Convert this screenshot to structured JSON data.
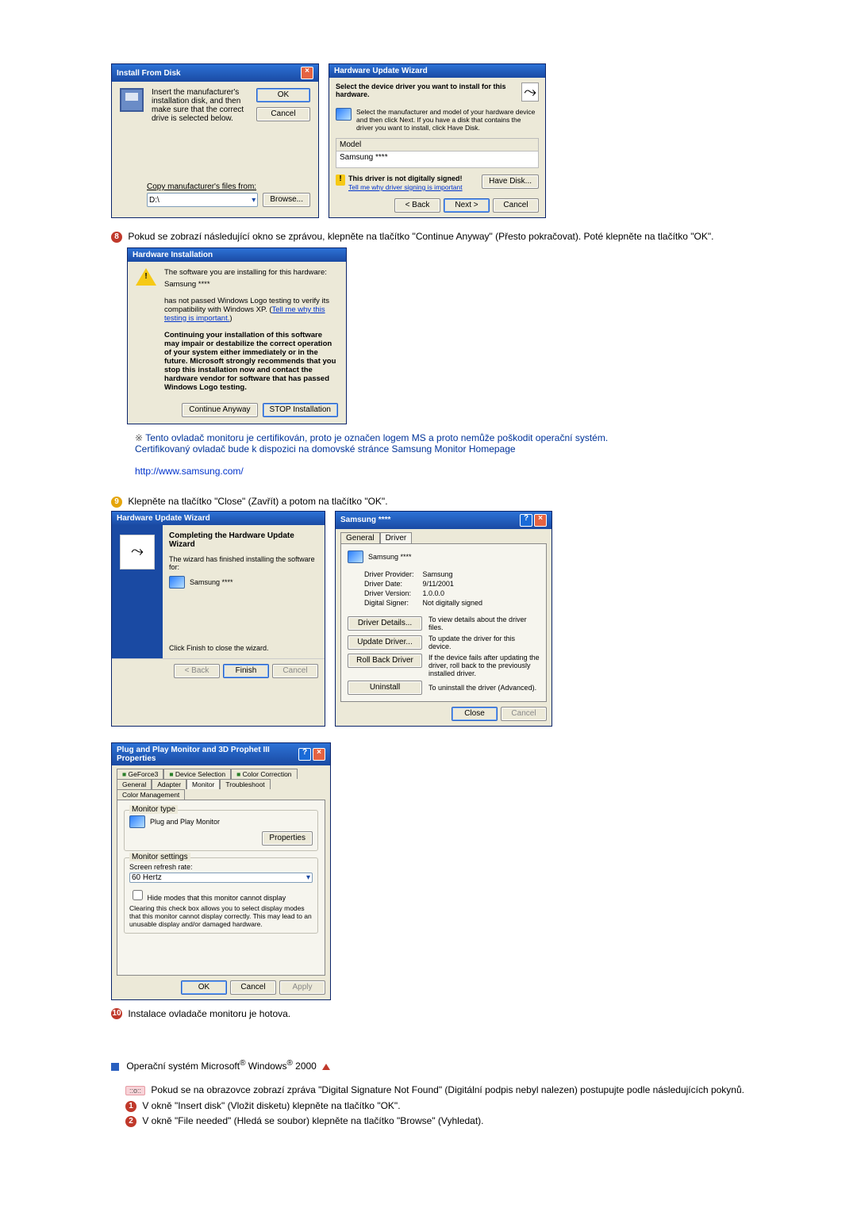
{
  "install_from_disk": {
    "title": "Install From Disk",
    "instruction": "Insert the manufacturer's installation disk, and then make sure that the correct drive is selected below.",
    "ok": "OK",
    "cancel": "Cancel",
    "copy_label": "Copy manufacturer's files from:",
    "drive_value": "D:\\",
    "browse": "Browse..."
  },
  "hw_select": {
    "title": "Hardware Update Wizard",
    "header": "Select the device driver you want to install for this hardware.",
    "instruction": "Select the manufacturer and model of your hardware device and then click Next. If you have a disk that contains the driver you want to install, click Have Disk.",
    "model_header": "Model",
    "model_value": "Samsung ****",
    "not_signed": "This driver is not digitally signed!",
    "why_link": "Tell me why driver signing is important",
    "have_disk": "Have Disk...",
    "back": "< Back",
    "next": "Next >",
    "cancel": "Cancel"
  },
  "step8": {
    "text": "Pokud se zobrazí následující okno se zprávou, klepněte na tlačítko \"Continue Anyway\" (Přesto pokračovat). Poté klepněte na tlačítko \"OK\"."
  },
  "hw_installation": {
    "title": "Hardware Installation",
    "line1": "The software you are installing for this hardware:",
    "device": "Samsung ****",
    "line2a": "has not passed Windows Logo testing to verify its compatibility with Windows XP. (",
    "testing_link": "Tell me why this testing is important.",
    "line2b": ")",
    "warning": "Continuing your installation of this software may impair or destabilize the correct operation of your system either immediately or in the future. Microsoft strongly recommends that you stop this installation now and contact the hardware vendor for software that has passed Windows Logo testing.",
    "continue": "Continue Anyway",
    "stop": "STOP Installation"
  },
  "note": {
    "marker": "※",
    "para1": "Tento ovladač monitoru je certifikován, proto je označen logem MS a proto nemůže poškodit operační systém.",
    "para2": "Certifikovaný ovladač bude k dispozici na domovské stránce Samsung Monitor Homepage",
    "url": "http://www.samsung.com/"
  },
  "step9": {
    "text": "Klepněte na tlačítko \"Close\" (Zavřít) a potom na tlačítko \"OK\"."
  },
  "hw_complete": {
    "title": "Hardware Update Wizard",
    "heading": "Completing the Hardware Update Wizard",
    "finished_text": "The wizard has finished installing the software for:",
    "device": "Samsung ****",
    "finish_hint": "Click Finish to close the wizard.",
    "back": "< Back",
    "finish": "Finish",
    "cancel": "Cancel"
  },
  "driver_props": {
    "title": "Samsung ****",
    "tab_general": "General",
    "tab_driver": "Driver",
    "device": "Samsung ****",
    "provider_label": "Driver Provider:",
    "provider_value": "Samsung",
    "date_label": "Driver Date:",
    "date_value": "9/11/2001",
    "version_label": "Driver Version:",
    "version_value": "1.0.0.0",
    "signer_label": "Digital Signer:",
    "signer_value": "Not digitally signed",
    "btn_details": "Driver Details...",
    "desc_details": "To view details about the driver files.",
    "btn_update": "Update Driver...",
    "desc_update": "To update the driver for this device.",
    "btn_rollback": "Roll Back Driver",
    "desc_rollback": "If the device fails after updating the driver, roll back to the previously installed driver.",
    "btn_uninstall": "Uninstall",
    "desc_uninstall": "To uninstall the driver (Advanced).",
    "close": "Close",
    "cancel": "Cancel"
  },
  "display_props": {
    "title": "Plug and Play Monitor and 3D Prophet III Properties",
    "tabs": {
      "geforce": "GeForce3",
      "adapter": "Adapter",
      "device": "Device Selection",
      "monitor": "Monitor",
      "trouble": "Troubleshoot",
      "color_corr": "Color Correction",
      "color_mgmt": "Color Management",
      "general": "General"
    },
    "monitor_type_label": "Monitor type",
    "monitor_type_value": "Plug and Play Monitor",
    "properties": "Properties",
    "monitor_settings_label": "Monitor settings",
    "refresh_label": "Screen refresh rate:",
    "refresh_value": "60 Hertz",
    "hide_label": "Hide modes that this monitor cannot display",
    "hide_desc": "Clearing this check box allows you to select display modes that this monitor cannot display correctly. This may lead to an unusable display and/or damaged hardware.",
    "ok": "OK",
    "cancel": "Cancel",
    "apply": "Apply"
  },
  "step10": {
    "text": "Instalace ovladače monitoru je hotova."
  },
  "os2000": {
    "heading_pre": "Operační systém Microsoft",
    "heading_mid": " Windows",
    "heading_post": " 2000",
    "intro": "Pokud se na obrazovce zobrazí zpráva \"Digital Signature Not Found\" (Digitální podpis nebyl nalezen) postupujte podle následujících pokynů.",
    "step1": "V okně \"Insert disk\" (Vložit disketu) klepněte na tlačítko \"OK\".",
    "step2": "V okně \"File needed\" (Hledá se soubor) klepněte na tlačítko \"Browse\" (Vyhledat)."
  }
}
